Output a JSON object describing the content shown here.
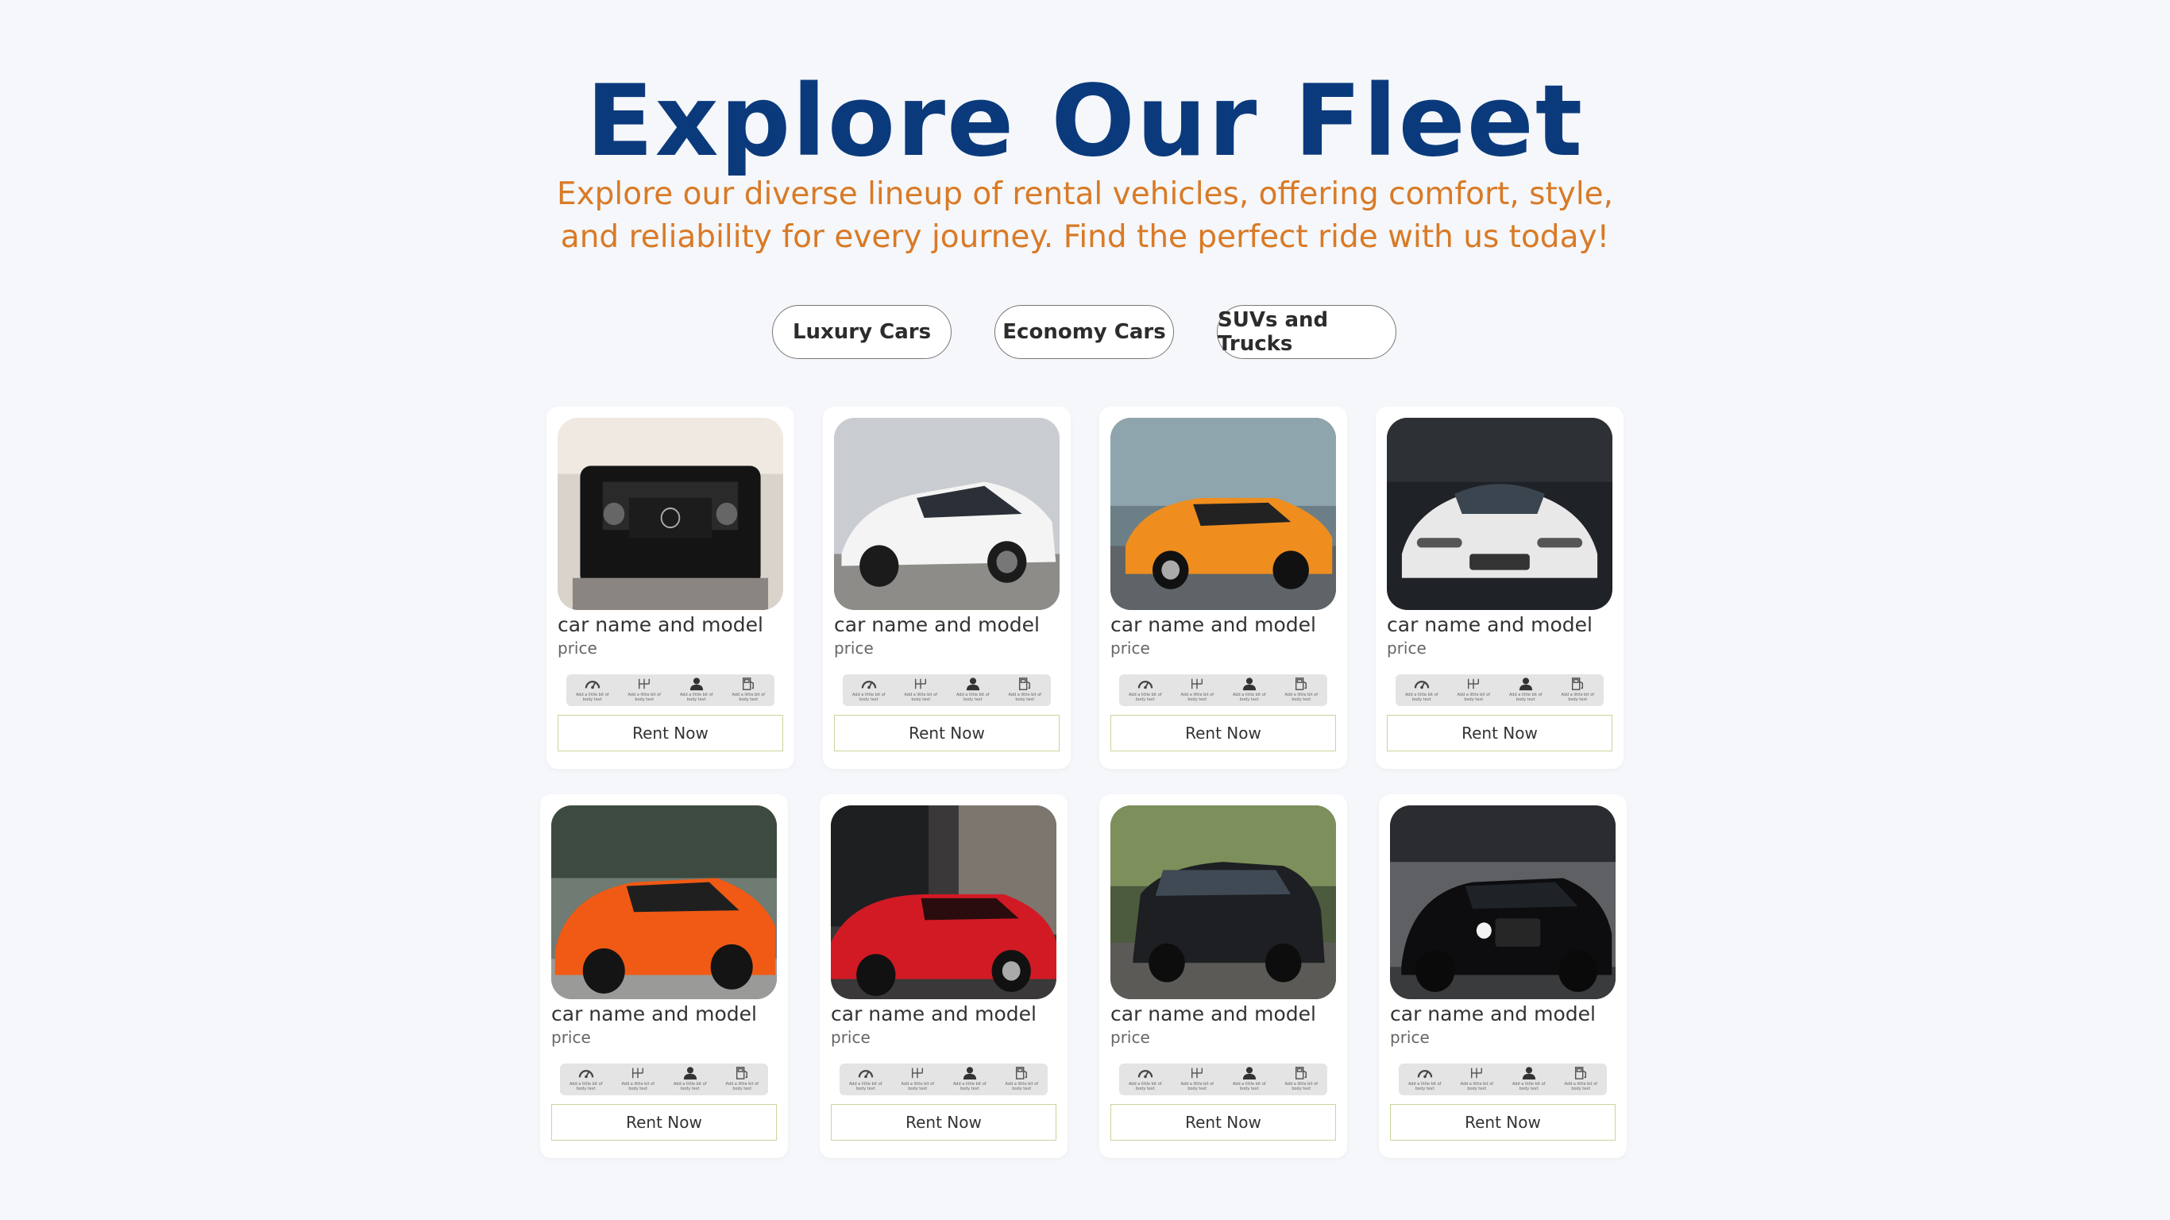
{
  "hero": {
    "title": "Explore Our Fleet",
    "subtitle": "Explore our diverse lineup of rental vehicles, offering comfort, style, and reliability for every journey. Find the perfect ride with us today!"
  },
  "filters": [
    {
      "label": "Luxury Cars"
    },
    {
      "label": "Economy Cars"
    },
    {
      "label": "SUVs and Trucks"
    }
  ],
  "cards": [
    {
      "name": "car name and model",
      "price": "price",
      "button": "Rent Now",
      "photo": "black-suv-photo"
    },
    {
      "name": "car name and model",
      "price": "price",
      "button": "Rent Now",
      "photo": "white-hatchback-photo"
    },
    {
      "name": "car name and model",
      "price": "price",
      "button": "Rent Now",
      "photo": "orange-supercar-photo"
    },
    {
      "name": "car name and model",
      "price": "price",
      "button": "Rent Now",
      "photo": "white-sportscar-photo"
    },
    {
      "name": "car name and model",
      "price": "price",
      "button": "Rent Now",
      "photo": "orange-sportscar-photo"
    },
    {
      "name": "car name and model",
      "price": "price",
      "button": "Rent Now",
      "photo": "red-sportscar-photo"
    },
    {
      "name": "car name and model",
      "price": "price",
      "button": "Rent Now",
      "photo": "dark-suv-photo"
    },
    {
      "name": "car name and model",
      "price": "price",
      "button": "Rent Now",
      "photo": "black-luxury-photo"
    }
  ],
  "specs": [
    {
      "icon": "speedometer-icon",
      "text": "Add a little bit of body text"
    },
    {
      "icon": "gearbox-icon",
      "text": "Add a little bit of body text"
    },
    {
      "icon": "person-icon",
      "text": "Add a little bit of body text"
    },
    {
      "icon": "fuel-icon",
      "text": "Add a little bit of body text"
    }
  ],
  "colors": {
    "title": "#0b3a7c",
    "subtitle": "#d97a26",
    "button_border": "#c6d69a",
    "background": "#f5f7fa"
  }
}
